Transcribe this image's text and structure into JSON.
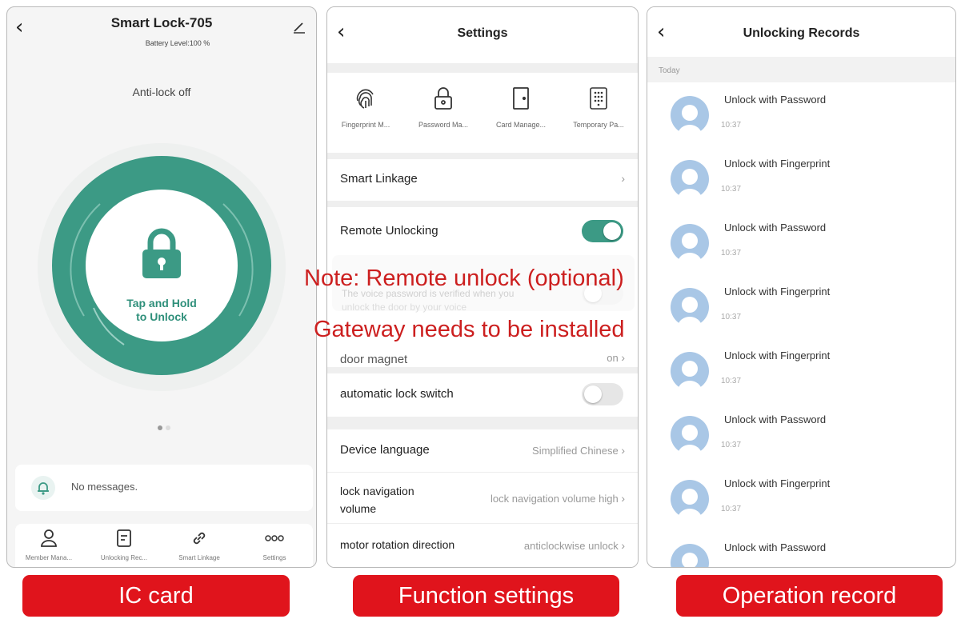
{
  "colors": {
    "teal": "#3c9a85",
    "red": "#e0141c",
    "toggle_on": "#3c9a85",
    "toggle_off": "#e6e6e6",
    "note": "#cc1f1f"
  },
  "panel1": {
    "title": "Smart Lock-705",
    "battery": "Battery Level:100 %",
    "anti_lock": "Anti-lock off",
    "tap_line1": "Tap and Hold",
    "tap_line2": "to Unlock",
    "message": "No messages.",
    "nav": [
      {
        "label": "Member Mana...",
        "icon": "person-icon"
      },
      {
        "label": "Unlocking Rec...",
        "icon": "record-icon"
      },
      {
        "label": "Smart Linkage",
        "icon": "link-icon"
      },
      {
        "label": "Settings",
        "icon": "more-icon"
      }
    ]
  },
  "panel2": {
    "title": "Settings",
    "icons": [
      {
        "label": "Fingerprint M...",
        "icon": "fingerprint-icon"
      },
      {
        "label": "Password Ma...",
        "icon": "padlock-icon"
      },
      {
        "label": "Card Manage...",
        "icon": "door-icon"
      },
      {
        "label": "Temporary Pa...",
        "icon": "keypad-icon"
      }
    ],
    "smart_linkage": "Smart Linkage",
    "remote_unlocking": "Remote Unlocking",
    "remote_unlocking_on": true,
    "voice_desc_line1": "The voice password is verified when you",
    "voice_desc_line2": "unlock the door by your voice",
    "door_magnet": "door magnet",
    "door_magnet_value": "on",
    "auto_lock": "automatic lock switch",
    "auto_lock_on": false,
    "device_language": "Device language",
    "device_language_value": "Simplified Chinese",
    "lock_nav_line1": "lock navigation",
    "lock_nav_line2": "volume",
    "lock_nav_value": "lock navigation volume high",
    "motor_rotation": "motor rotation direction",
    "motor_rotation_value": "anticlockwise unlock"
  },
  "panel3": {
    "title": "Unlocking Records",
    "today": "Today",
    "records": [
      {
        "title": "Unlock with Password",
        "time": "10:37"
      },
      {
        "title": "Unlock with Fingerprint",
        "time": "10:37"
      },
      {
        "title": "Unlock with Password",
        "time": "10:37"
      },
      {
        "title": "Unlock with Fingerprint",
        "time": "10:37"
      },
      {
        "title": "Unlock with Fingerprint",
        "time": "10:37"
      },
      {
        "title": "Unlock with Password",
        "time": "10:37"
      },
      {
        "title": "Unlock with Fingerprint",
        "time": "10:37"
      },
      {
        "title": "Unlock with Password",
        "time": ""
      }
    ]
  },
  "overlay": {
    "note_line1": "Note: Remote unlock (optional)",
    "note_line2": "Gateway needs to be installed"
  },
  "badges": {
    "left": "IC card",
    "middle": "Function settings",
    "right": "Operation record"
  }
}
